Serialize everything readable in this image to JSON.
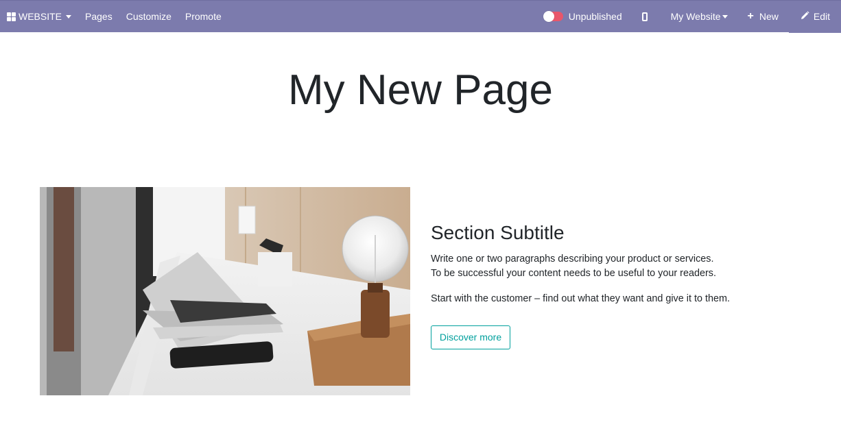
{
  "navbar": {
    "brand_label": "WEBSITE",
    "menu": [
      "Pages",
      "Customize",
      "Promote"
    ],
    "publish_status": "Unpublished",
    "website_selector": "My Website",
    "new_label": "New",
    "edit_label": "Edit",
    "colors": {
      "bar": "#7c7bad",
      "toggle_off": "#e8566b"
    }
  },
  "page": {
    "title": "My New Page",
    "section": {
      "subtitle": "Section Subtitle",
      "paragraph1_line1": "Write one or two paragraphs describing your product or services.",
      "paragraph1_line2": "To be successful your content needs to be useful to your readers.",
      "paragraph2": "Start with the customer – find out what they want and give it to them.",
      "cta_label": "Discover more",
      "cta_color": "#00a09d"
    }
  }
}
